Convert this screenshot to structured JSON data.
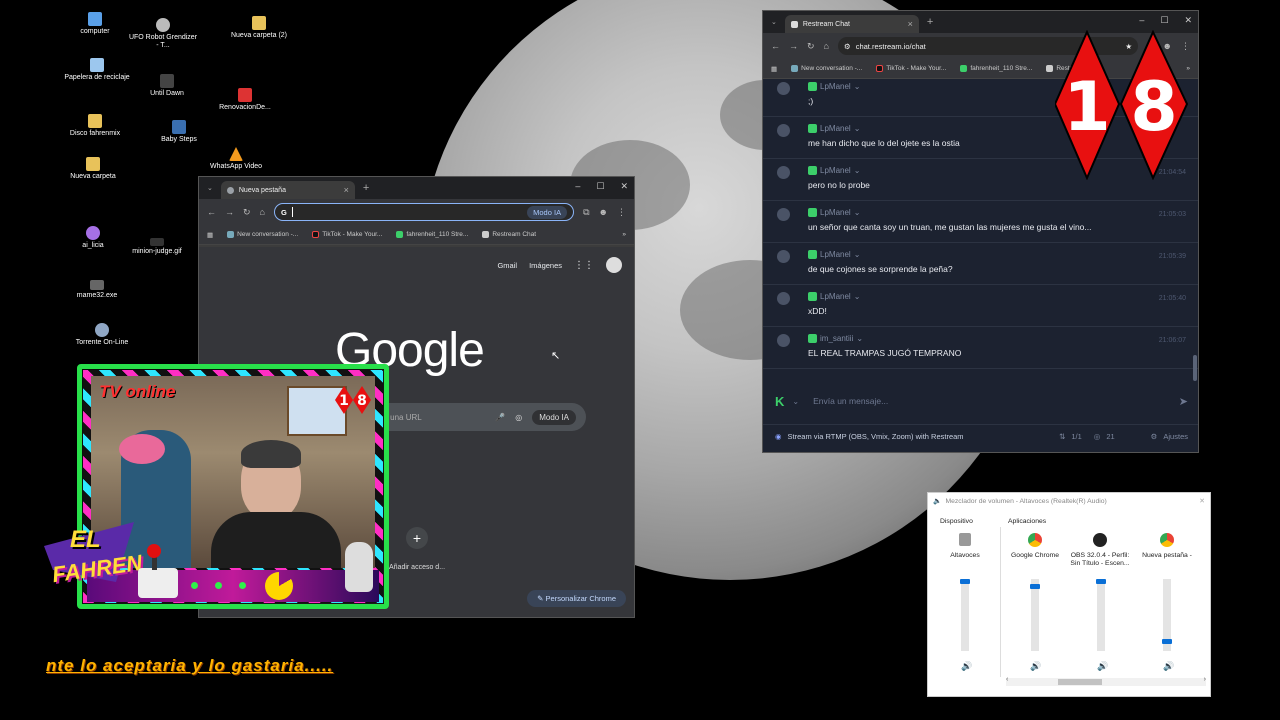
{
  "desktop": {
    "icons": [
      {
        "label": "computer"
      },
      {
        "label": "UFO Robot Grendizer - T..."
      },
      {
        "label": "Nueva carpeta (2)"
      },
      {
        "label": "Papelera de reciclaje"
      },
      {
        "label": "Until Dawn"
      },
      {
        "label": "RenovacionDe..."
      },
      {
        "label": "Disco fahrenmix"
      },
      {
        "label": "Baby Steps"
      },
      {
        "label": "Nueva carpeta"
      },
      {
        "label": "WhatsApp Video"
      },
      {
        "label": "ai_licia"
      },
      {
        "label": "minion-judge.gif"
      },
      {
        "label": "mame32.exe"
      },
      {
        "label": "Torrente On-Line"
      }
    ]
  },
  "chrome": {
    "tab_title": "Nueva pestaña",
    "omnibox_ai": "Modo IA",
    "bookmarks": [
      "New conversation -...",
      "TikTok - Make Your...",
      "fahrenheit_110 Stre...",
      "Restream Chat"
    ],
    "gmail": "Gmail",
    "images": "Imágenes",
    "logo": "Google",
    "search_placeholder": "ba una URL",
    "search_ai": "Modo IA",
    "shortcut_label": "Añadir acceso d...",
    "customize": "Personalizar Chrome"
  },
  "restream": {
    "tab_title": "Restream Chat",
    "url": "chat.restream.io/chat",
    "bookmarks": [
      "New conversation -...",
      "TikTok - Make Your...",
      "fahrenheit_110 Stre...",
      "Restream Chat"
    ],
    "messages": [
      {
        "user": "LpManel",
        "text": ";)",
        "time": ""
      },
      {
        "user": "LpManel",
        "text": "me han dicho que lo del ojete es la ostia",
        "time": ""
      },
      {
        "user": "LpManel",
        "text": "pero no lo probe",
        "time": "21:04:54"
      },
      {
        "user": "LpManel",
        "text": "un señor que canta soy un truan, me gustan las mujeres me gusta el vino...",
        "time": "21:05:03"
      },
      {
        "user": "LpManel",
        "text": "de que cojones se sorprende la peña?",
        "time": "21:05:39"
      },
      {
        "user": "LpManel",
        "text": "xDD!",
        "time": "21:05:40"
      },
      {
        "user": "im_santiii",
        "text": "EL REAL TRAMPAS JUGÓ TEMPRANO",
        "time": "21:06:07"
      }
    ],
    "input_placeholder": "Envía un mensaje...",
    "footer_text": "Stream via RTMP (OBS, Vmix, Zoom) with Restream",
    "footer_count": "1/1",
    "viewers": "21",
    "settings": "Ajustes"
  },
  "overlay": {
    "badge_digits": [
      "1",
      "8"
    ],
    "cam_title": "TV online",
    "cam_badge": [
      "1",
      "8"
    ],
    "logo_el": "EL",
    "logo_name": "FAHREN",
    "ticker": "nte lo aceptaria y lo gastaria....."
  },
  "mixer": {
    "title": "Mezclador de volumen - Altavoces (Realtek(R) Audio)",
    "device_header": "Dispositivo",
    "apps_header": "Aplicaciones",
    "channels": [
      {
        "label": "Altavoces",
        "level": 1.0
      },
      {
        "label": "Google Chrome",
        "level": 0.93
      },
      {
        "label": "OBS 32.0.4 - Perfil: Sin Título - Escen...",
        "level": 1.0
      },
      {
        "label": "Nueva pestaña -",
        "level": 0.1
      }
    ],
    "accent": "#0a6fd6"
  }
}
